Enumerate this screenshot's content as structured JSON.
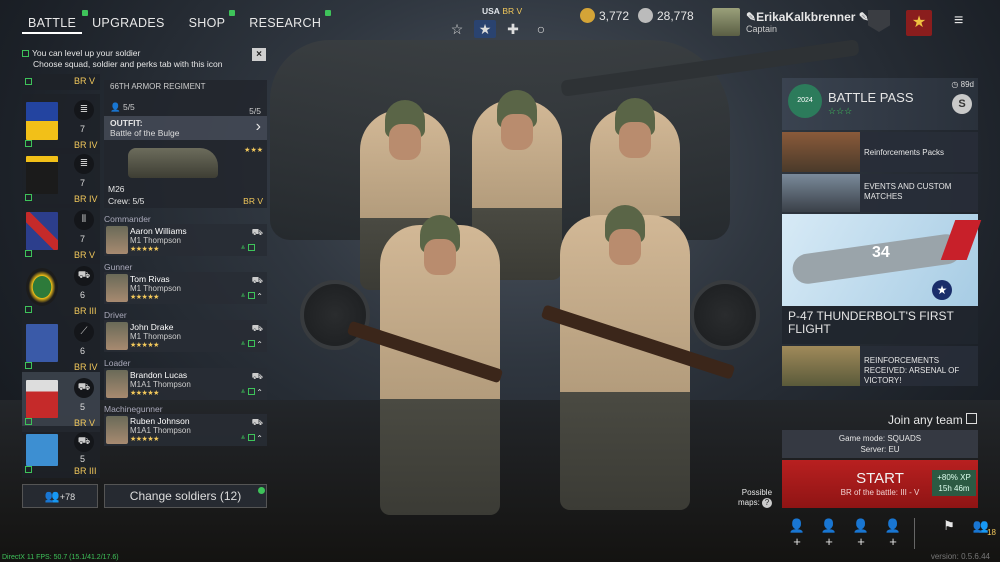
{
  "nav": {
    "tabs": [
      "BATTLE",
      "UPGRADES",
      "SHOP",
      "RESEARCH"
    ],
    "active": "BATTLE"
  },
  "modes": {
    "nation": "USA",
    "br": "BR V"
  },
  "currency": {
    "gold": "3,772",
    "silver": "28,778"
  },
  "user": {
    "name": "ErikaKalkbrenner",
    "rank": "Captain"
  },
  "hint": {
    "line1": "You can level up your soldier",
    "line2": "Choose squad, soldier and perks tab with this icon",
    "close": "×"
  },
  "squads": [
    {
      "count": "",
      "br": "BR V"
    },
    {
      "count": "7",
      "br": "BR IV"
    },
    {
      "count": "7",
      "br": "BR IV"
    },
    {
      "count": "7",
      "br": "BR V"
    },
    {
      "count": "6",
      "br": "BR III"
    },
    {
      "count": "6",
      "br": "BR IV"
    },
    {
      "count": "5",
      "br": "BR V"
    },
    {
      "count": "5",
      "br": "BR III"
    }
  ],
  "regiment": {
    "name": "66TH ARMOR REGIMENT",
    "cap": "5/5",
    "cap2": "5/5"
  },
  "outfit": {
    "title": "OUTFIT:",
    "name": "Battle of the Bulge"
  },
  "vehicle": {
    "name": "M26",
    "crew": "Crew: 5/5",
    "br": "BR V",
    "stars": "★★★"
  },
  "soldiers": [
    {
      "role": "Commander",
      "name": "Aaron Williams",
      "weapon": "M1 Thompson"
    },
    {
      "role": "Gunner",
      "name": "Tom Rivas",
      "weapon": "M1 Thompson"
    },
    {
      "role": "Driver",
      "name": "John Drake",
      "weapon": "M1 Thompson"
    },
    {
      "role": "Loader",
      "name": "Brandon Lucas",
      "weapon": "M1A1 Thompson"
    },
    {
      "role": "Machinegunner",
      "name": "Ruben Johnson",
      "weapon": "M1A1 Thompson"
    }
  ],
  "stars5": "★★★★★",
  "bottom": {
    "reserve": "+78",
    "change": "Change soldiers (12)"
  },
  "battlepass": {
    "title": "BATTLE PASS",
    "stars": "☆☆☆",
    "days": "89d",
    "coin": "S",
    "logo": "2024"
  },
  "cards": [
    {
      "text": "Reinforcements Packs"
    },
    {
      "text": "EVENTS AND CUSTOM MATCHES"
    },
    {
      "text": "P-47 THUNDERBOLT'S FIRST FLIGHT"
    },
    {
      "text": "REINFORCEMENTS RECEIVED: ARSENAL OF VICTORY!"
    }
  ],
  "plane_number": "34",
  "join": "Join any team",
  "gamemode": {
    "mode": "Game mode: SQUADS",
    "server": "Server: EU"
  },
  "start": {
    "label": "START",
    "br": "BR of the battle: III - V",
    "xp": "+80% XP",
    "time": "15h 46m"
  },
  "maps": {
    "line1": "Possible",
    "line2": "maps:"
  },
  "squad_count": "18",
  "version": "version: 0.5.6.44",
  "debug": "DirectX 11 FPS: 50.7 (15.1/41.2/17.6)",
  "colors": {
    "accent": "#3ec35a",
    "br": "#f2c85b",
    "start": "#b82020"
  }
}
